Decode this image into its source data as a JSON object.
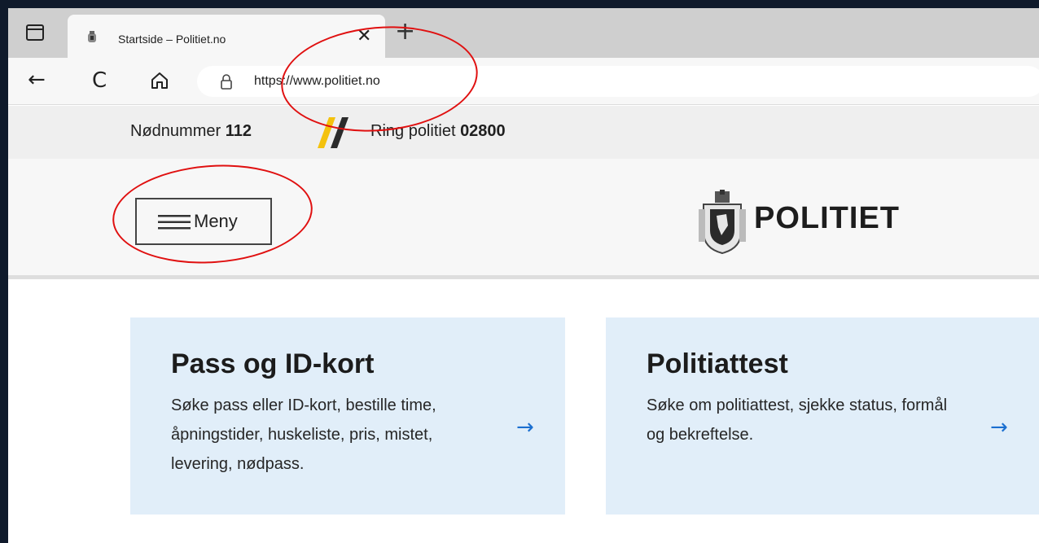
{
  "browser": {
    "tab_title": "Startside – Politiet.no",
    "tab_close": "✕",
    "new_tab": "+",
    "url": "https://www.politiet.no",
    "nav": {
      "back": "←",
      "reload": "C"
    }
  },
  "emergency": {
    "emergency_label": "Nødnummer ",
    "emergency_number": "112",
    "police_label": "Ring politiet ",
    "police_number": "02800",
    "accent_colors": [
      "#f4c20d",
      "#2b2b2b"
    ]
  },
  "header": {
    "menu_label": "Meny",
    "logo_text": "POLITIET"
  },
  "cards": [
    {
      "title": "Pass og ID-kort",
      "text": "Søke pass eller ID-kort, bestille time, åpningstider, huskeliste, pris, mistet, levering, nødpass.",
      "arrow": "→"
    },
    {
      "title": "Politiattest",
      "text": "Søke om politiattest, sjekke status, formål og bekreftelse.",
      "arrow": "→"
    }
  ],
  "colors": {
    "card_background": "#e1eef9",
    "arrow": "#1b6fd0",
    "annotation": "#e01010"
  },
  "icons": [
    "tab-actions-icon",
    "police-crest-icon",
    "close-icon",
    "plus-icon",
    "back-arrow-icon",
    "reload-icon",
    "home-icon",
    "lock-icon",
    "hamburger-icon",
    "arrow-right-icon"
  ]
}
